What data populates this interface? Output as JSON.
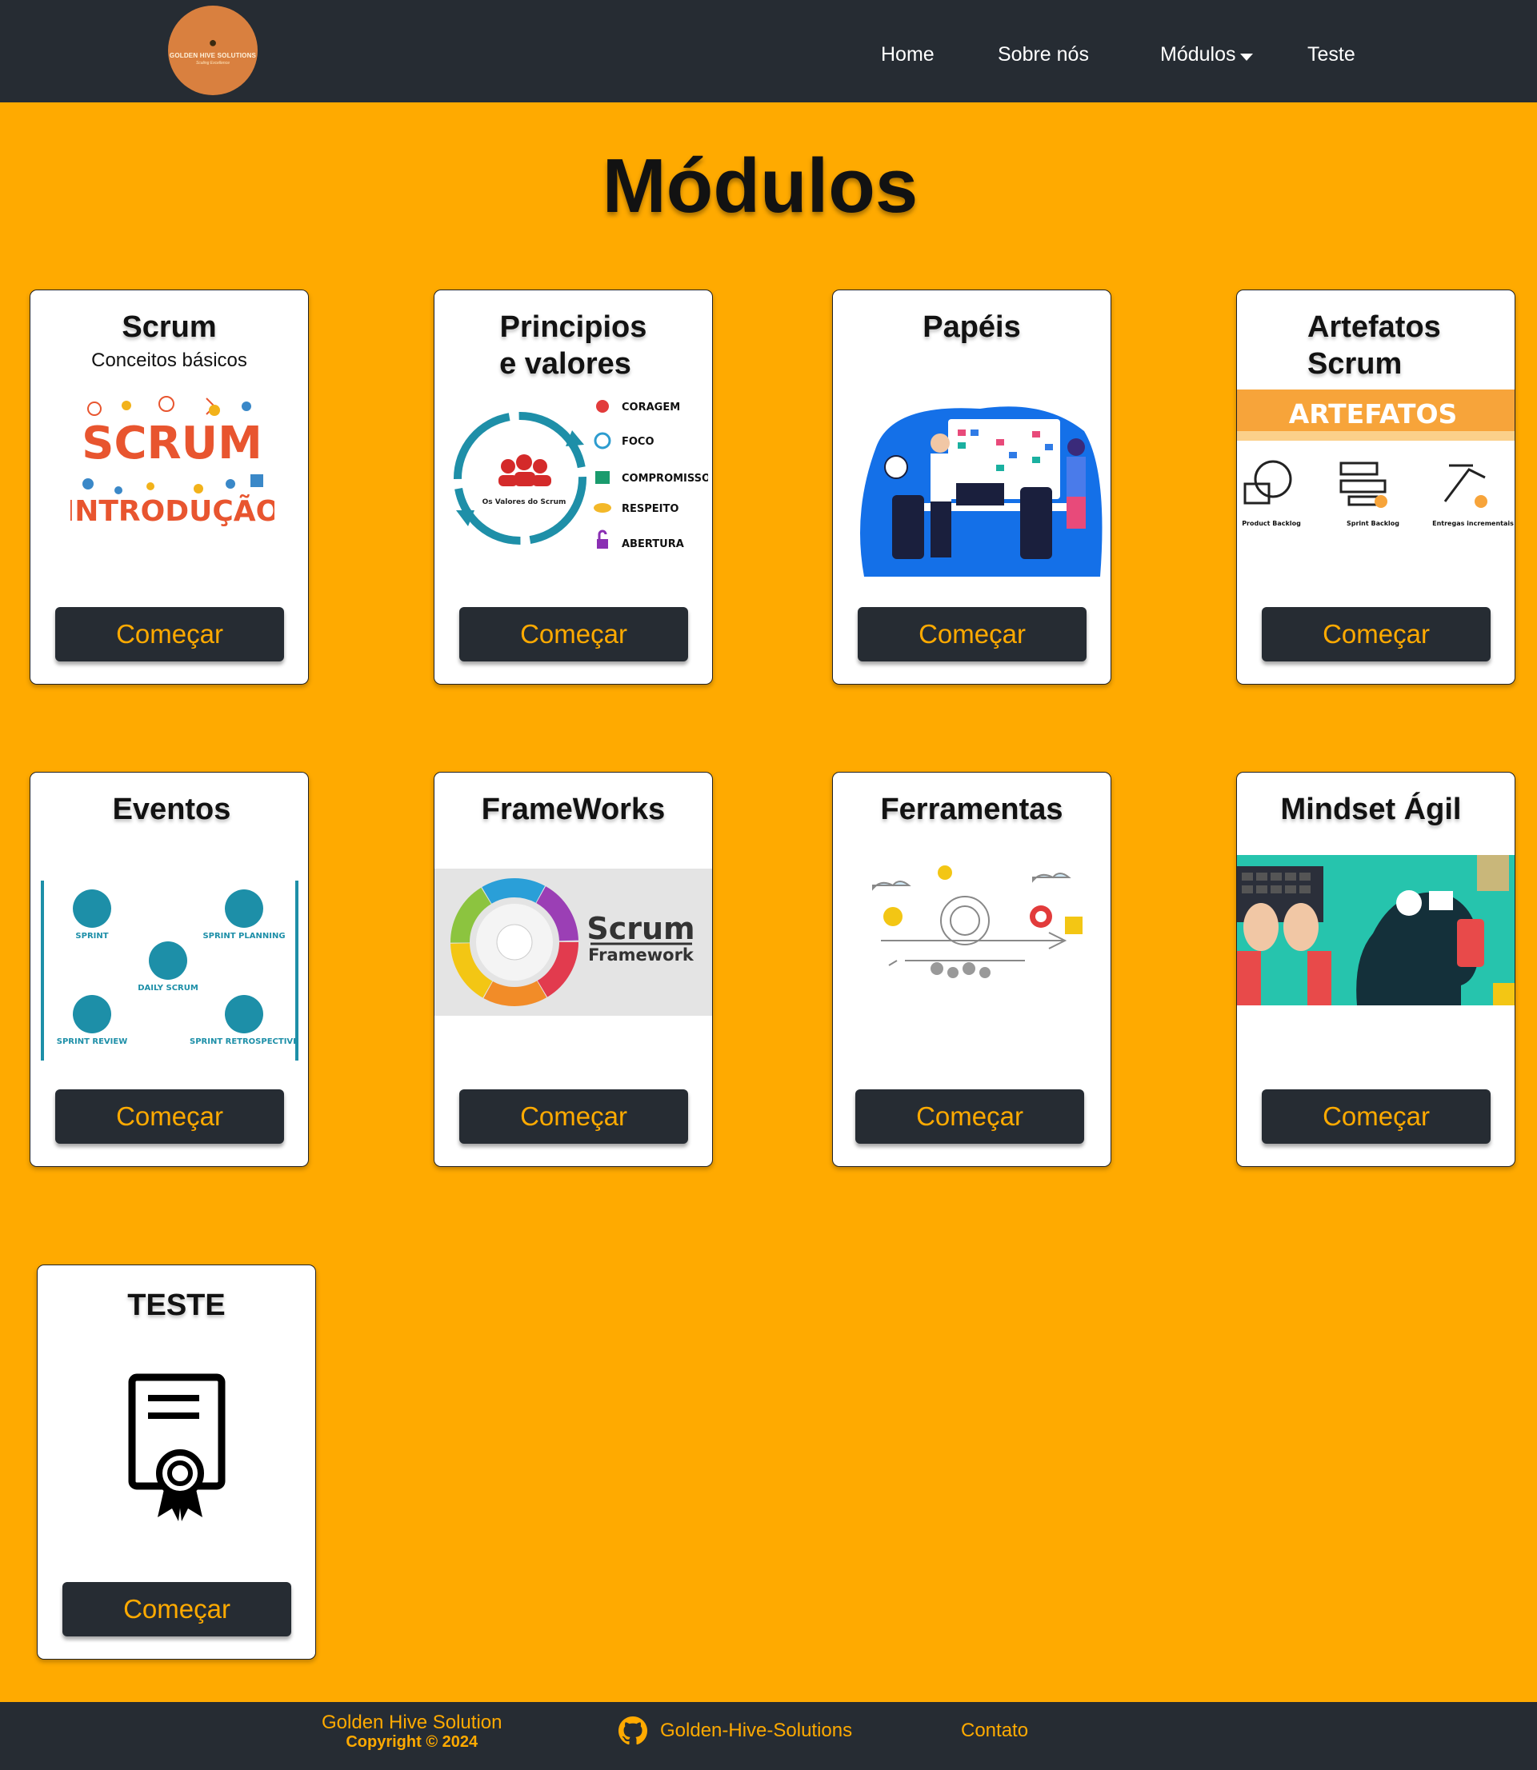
{
  "nav": {
    "logo_title": "GOLDEN HIVE SOLUTIONS",
    "logo_tagline": "Scaling Excellence",
    "links": [
      "Home",
      "Sobre nós",
      "Módulos",
      "Teste"
    ]
  },
  "page_title": "Módulos",
  "cards": [
    {
      "title_line1": "Scrum",
      "title_line2": "",
      "subtitle": "Conceitos básicos",
      "image": "scrum-introducao-illustration",
      "image_text": [
        "SCRUM",
        "INTRODUÇÃO"
      ],
      "button": "Começar"
    },
    {
      "title_line1": "Principios",
      "title_line2": "e valores",
      "subtitle": "",
      "image": "scrum-values-cycle-illustration",
      "image_text": [
        "Os Valores do Scrum",
        "CORAGEM",
        "FOCO",
        "COMPROMISSO",
        "RESPEITO",
        "ABERTURA"
      ],
      "button": "Começar"
    },
    {
      "title_line1": "Papéis",
      "title_line2": "",
      "subtitle": "",
      "image": "team-board-illustration",
      "image_text": [],
      "button": "Começar"
    },
    {
      "title_line1": "Artefatos",
      "title_line2": "Scrum",
      "subtitle": "",
      "image": "artefatos-illustration",
      "image_text": [
        "ARTEFATOS",
        "Product Backlog",
        "Sprint Backlog",
        "Entregas incrementais"
      ],
      "button": "Começar"
    },
    {
      "title_line1": "Eventos",
      "title_line2": "",
      "subtitle": "",
      "image": "scrum-events-illustration",
      "image_text": [
        "SPRINT",
        "SPRINT PLANNING",
        "DAILY SCRUM",
        "SPRINT REVIEW",
        "SPRINT RETROSPECTIVE"
      ],
      "button": "Começar"
    },
    {
      "title_line1": "FrameWorks",
      "title_line2": "",
      "subtitle": "",
      "image": "scrum-framework-wheel-illustration",
      "image_text": [
        "Scrum",
        "Framework"
      ],
      "button": "Começar"
    },
    {
      "title_line1": "Ferramentas",
      "title_line2": "",
      "subtitle": "",
      "image": "tools-sketch-illustration",
      "image_text": [],
      "button": "Começar"
    },
    {
      "title_line1": "Mindset Ágil",
      "title_line2": "",
      "subtitle": "",
      "image": "agile-mindset-illustration",
      "image_text": [],
      "button": "Começar"
    },
    {
      "title_line1": "TESTE",
      "title_line2": "",
      "subtitle": "",
      "image": "certificate-icon",
      "image_text": [],
      "button": "Começar"
    }
  ],
  "footer": {
    "brand": "Golden Hive Solution",
    "copyright": "Copyright © 2024",
    "github_label": "Golden-Hive-Solutions",
    "contact": "Contato"
  },
  "colors": {
    "background": "#ffaa00",
    "navbar": "#262c33",
    "button_bg": "#262c33",
    "button_text": "#ffaa00",
    "card_bg": "#ffffff"
  }
}
